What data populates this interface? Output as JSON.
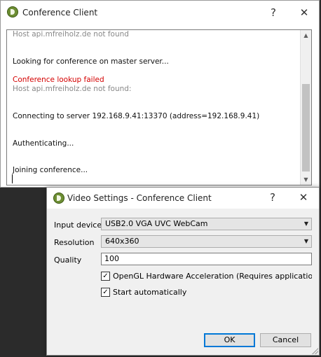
{
  "main_window": {
    "title": "Conference Client",
    "help_glyph": "?",
    "close_glyph": "✕",
    "log_lines": [
      {
        "text": "Host api.mfreiholz.de not found",
        "style": "gray"
      },
      {
        "text": "Looking for conference on master server...",
        "style": "normal"
      },
      {
        "text": "Conference lookup failed",
        "style": "red"
      },
      {
        "text": "Host api.mfreiholz.de not found:",
        "style": "gray"
      },
      {
        "text": "Connecting to server 192.168.9.41:13370 (address=192.168.9.41)",
        "style": "normal"
      },
      {
        "text": "Authenticating...",
        "style": "normal"
      },
      {
        "text": "Joining conference...",
        "style": "normal"
      }
    ],
    "scroll_up_glyph": "▲",
    "scroll_down_glyph": "▼"
  },
  "dialog": {
    "title": "Video Settings - Conference Client",
    "help_glyph": "?",
    "close_glyph": "✕",
    "input_device_label": "Input device",
    "input_device_value": "USB2.0 VGA UVC WebCam",
    "resolution_label": "Resolution",
    "resolution_value": "640x360",
    "quality_label": "Quality",
    "quality_value": "100",
    "opengl_label": "OpenGL Hardware Acceleration (Requires application restar",
    "opengl_checked": true,
    "autostart_label": "Start automatically",
    "autostart_checked": true,
    "check_glyph": "✓",
    "combo_arrow": "▼",
    "ok_label": "OK",
    "cancel_label": "Cancel"
  },
  "colors": {
    "error_text": "#d40000",
    "muted_text": "#888888",
    "app_icon": "#6d8e33",
    "default_button_border": "#0078d7"
  }
}
